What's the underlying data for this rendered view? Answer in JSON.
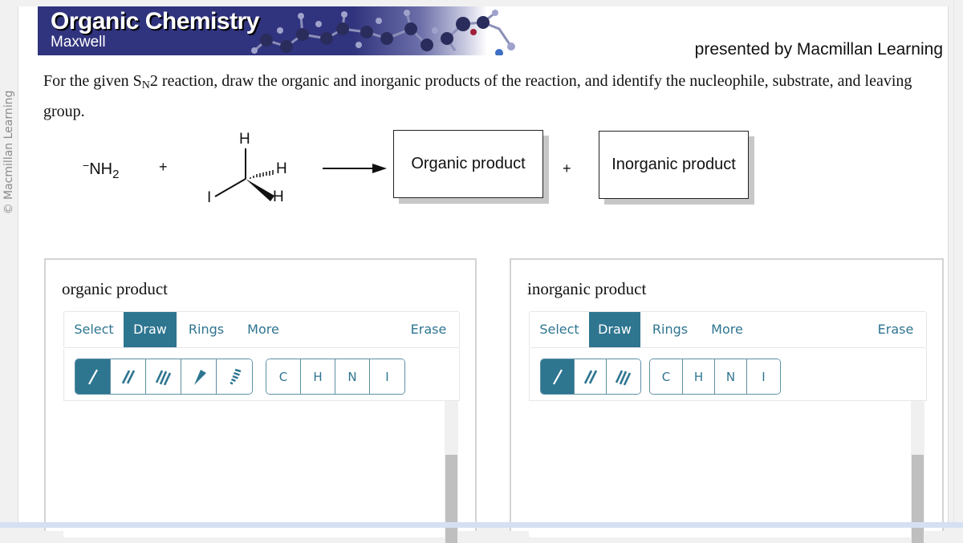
{
  "sidebar": {
    "copyright": "© Macmillan Learning"
  },
  "banner": {
    "title": "Organic Chemistry",
    "author": "Maxwell",
    "presented_by": "presented by Macmillan Learning",
    "background_color": "#30337d"
  },
  "question": {
    "prefix": "For the given S",
    "subscript": "N",
    "suffix": "2 reaction, draw the organic and inorganic products of the reaction, and identify the nucleophile, substrate, and leaving group."
  },
  "reaction": {
    "nucleophile": "NH",
    "nucleophile_charge": "−",
    "nucleophile_subscript": "2",
    "plus1": "+",
    "substrate_atoms": {
      "top_h": "H",
      "hashed_h": "H",
      "wedge_h": "H",
      "leaving_group": "I"
    },
    "organic_box": "Organic product",
    "plus2": "+",
    "inorganic_box": "Inorganic product"
  },
  "panels": [
    {
      "label": "organic product",
      "tabs": [
        "Select",
        "Draw",
        "Rings",
        "More"
      ],
      "active_tab": "Draw",
      "erase": "Erase",
      "bond_tools": [
        "single-bond",
        "double-bond",
        "triple-bond",
        "wedge-bond",
        "hash-bond"
      ],
      "active_bond": "single-bond",
      "elements": [
        "C",
        "H",
        "N",
        "I"
      ]
    },
    {
      "label": "inorganic product",
      "tabs": [
        "Select",
        "Draw",
        "Rings",
        "More"
      ],
      "active_tab": "Draw",
      "erase": "Erase",
      "bond_tools": [
        "single-bond",
        "double-bond",
        "triple-bond"
      ],
      "active_bond": "single-bond",
      "elements": [
        "C",
        "H",
        "N",
        "I"
      ]
    }
  ],
  "colors": {
    "accent": "#2e7590",
    "border": "#5d8fa4"
  }
}
